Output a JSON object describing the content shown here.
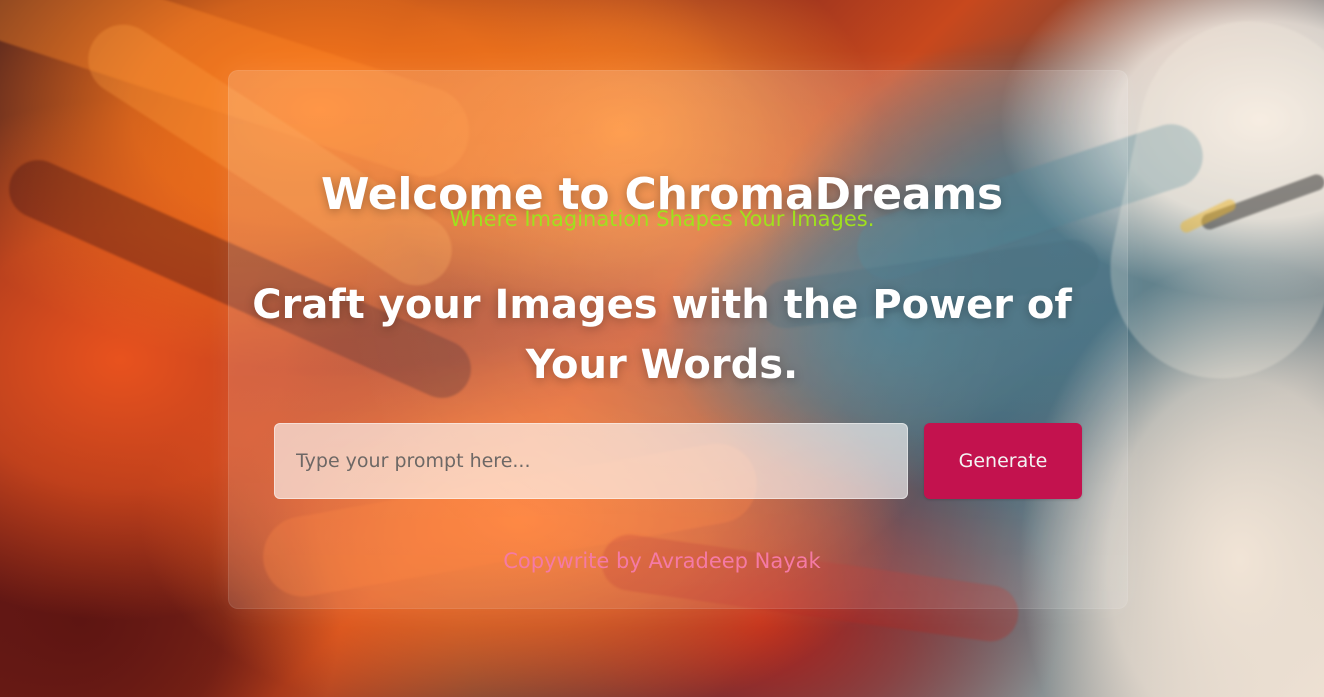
{
  "hero": {
    "title": "Welcome to ChromaDreams",
    "subtitle": "Where Imagination Shapes Your Images."
  },
  "main": {
    "headline_line_1": "Craft your Images with the Power of",
    "headline_line_2": "Your Words."
  },
  "prompt": {
    "placeholder": "Type your prompt here...",
    "button_label": "Generate"
  },
  "footer": {
    "text": "Copywrite by Avradeep Nayak"
  },
  "colors": {
    "accent_green": "#9fe11d",
    "button_pink": "#c3124e",
    "footer_pink": "#f57aa5"
  }
}
